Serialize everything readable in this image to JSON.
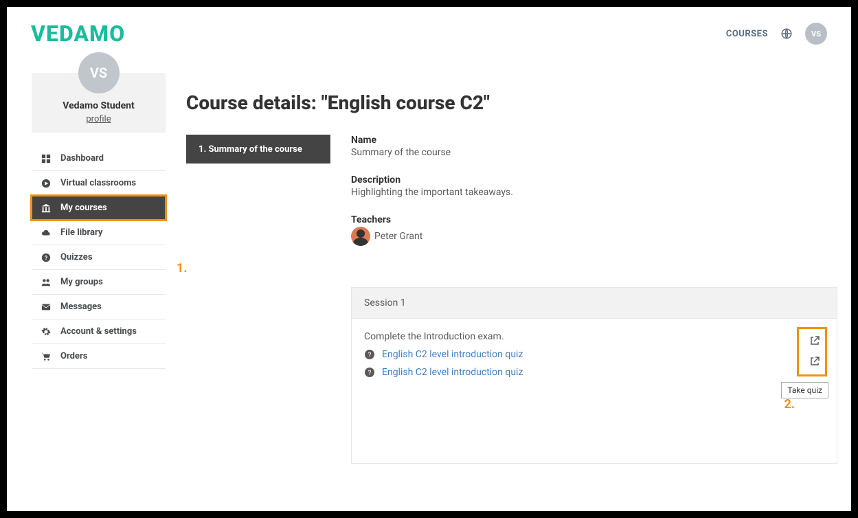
{
  "header": {
    "logo": "VEDAMO",
    "courses_link": "COURSES",
    "avatar_initials": "VS"
  },
  "profile": {
    "avatar_initials": "VS",
    "name": "Vedamo Student",
    "profile_link": "profile"
  },
  "nav": {
    "items": [
      {
        "label": "Dashboard"
      },
      {
        "label": "Virtual classrooms"
      },
      {
        "label": "My courses"
      },
      {
        "label": "File library"
      },
      {
        "label": "Quizzes"
      },
      {
        "label": "My groups"
      },
      {
        "label": "Messages"
      },
      {
        "label": "Account & settings"
      },
      {
        "label": "Orders"
      }
    ]
  },
  "page": {
    "title": "Course details: \"English course C2\"",
    "summary_tab": "1. Summary of the course",
    "name_label": "Name",
    "name_value": "Summary of the course",
    "desc_label": "Description",
    "desc_value": "Highlighting the important takeaways.",
    "teachers_label": "Teachers",
    "teacher_name": "Peter Grant"
  },
  "session": {
    "title": "Session 1",
    "instruction": "Complete the Introduction exam.",
    "quiz_1": "English C2 level introduction quiz",
    "quiz_2": "English C2 level introduction quiz",
    "tooltip": "Take quiz"
  },
  "annotations": {
    "one": "1.",
    "two": "2."
  }
}
